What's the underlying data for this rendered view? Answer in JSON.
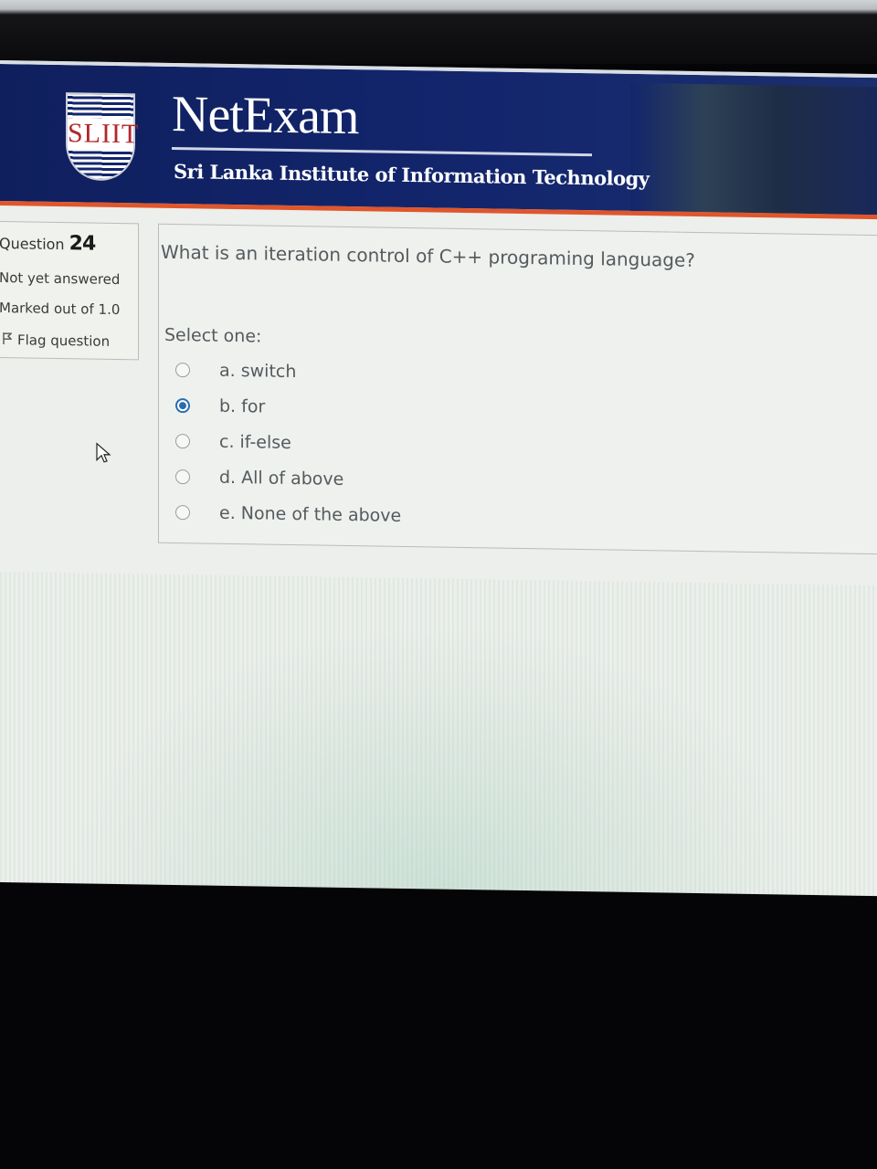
{
  "header": {
    "logo_text": "SLIIT",
    "app_title": "NetExam",
    "institute": "Sri Lanka Institute of Information Technology"
  },
  "info": {
    "question_label": "Question",
    "question_number": "24",
    "state": "Not yet answered",
    "marks": "Marked out of 1.0",
    "flag_label": "Flag question"
  },
  "question": {
    "text": "What is an iteration control of C++ programing language?",
    "prompt": "Select one:",
    "options": [
      {
        "label": "a. switch",
        "selected": false
      },
      {
        "label": "b. for",
        "selected": true
      },
      {
        "label": "c. if-else",
        "selected": false
      },
      {
        "label": "d. All of above",
        "selected": false
      },
      {
        "label": "e. None of the above",
        "selected": false
      }
    ]
  },
  "colors": {
    "header_blue": "#13266d",
    "accent_orange": "#e0562c",
    "radio_selected": "#2b6cb0"
  }
}
